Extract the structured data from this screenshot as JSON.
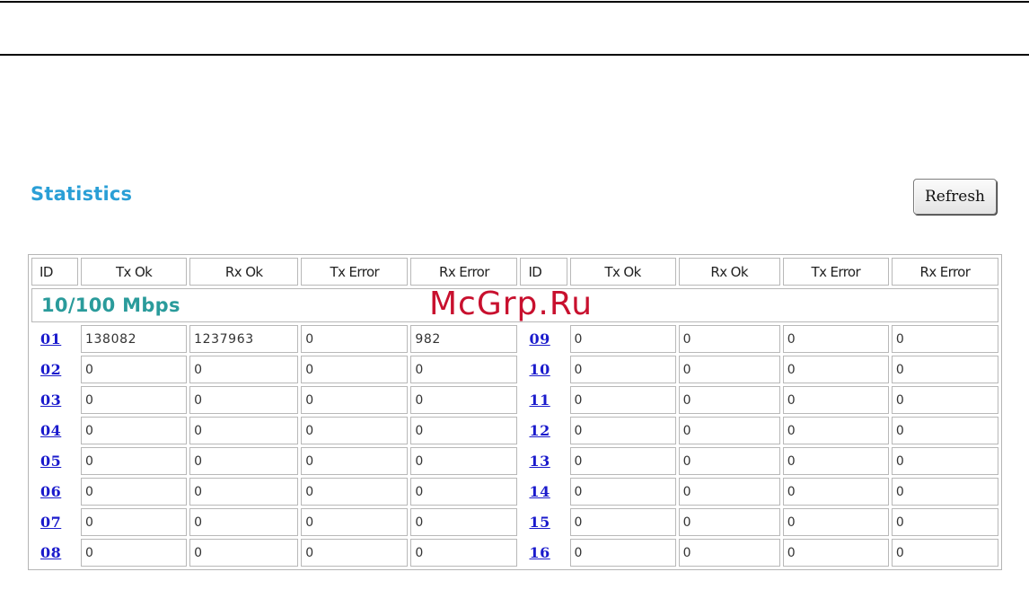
{
  "page": {
    "title": "Statistics",
    "refresh_label": "Refresh",
    "watermark": "McGrp.Ru"
  },
  "table": {
    "headers": [
      "ID",
      "Tx Ok",
      "Rx Ok",
      "Tx Error",
      "Rx Error",
      "ID",
      "Tx Ok",
      "Rx Ok",
      "Tx Error",
      "Rx Error"
    ],
    "section_label": "10/100 Mbps",
    "rows": [
      {
        "left_id": "01",
        "left_tx_ok": "138082",
        "left_rx_ok": "1237963",
        "left_tx_err": "0",
        "left_rx_err": "982",
        "right_id": "09",
        "right_tx_ok": "0",
        "right_rx_ok": "0",
        "right_tx_err": "0",
        "right_rx_err": "0"
      },
      {
        "left_id": "02",
        "left_tx_ok": "0",
        "left_rx_ok": "0",
        "left_tx_err": "0",
        "left_rx_err": "0",
        "right_id": "10",
        "right_tx_ok": "0",
        "right_rx_ok": "0",
        "right_tx_err": "0",
        "right_rx_err": "0"
      },
      {
        "left_id": "03",
        "left_tx_ok": "0",
        "left_rx_ok": "0",
        "left_tx_err": "0",
        "left_rx_err": "0",
        "right_id": "11",
        "right_tx_ok": "0",
        "right_rx_ok": "0",
        "right_tx_err": "0",
        "right_rx_err": "0"
      },
      {
        "left_id": "04",
        "left_tx_ok": "0",
        "left_rx_ok": "0",
        "left_tx_err": "0",
        "left_rx_err": "0",
        "right_id": "12",
        "right_tx_ok": "0",
        "right_rx_ok": "0",
        "right_tx_err": "0",
        "right_rx_err": "0"
      },
      {
        "left_id": "05",
        "left_tx_ok": "0",
        "left_rx_ok": "0",
        "left_tx_err": "0",
        "left_rx_err": "0",
        "right_id": "13",
        "right_tx_ok": "0",
        "right_rx_ok": "0",
        "right_tx_err": "0",
        "right_rx_err": "0"
      },
      {
        "left_id": "06",
        "left_tx_ok": "0",
        "left_rx_ok": "0",
        "left_tx_err": "0",
        "left_rx_err": "0",
        "right_id": "14",
        "right_tx_ok": "0",
        "right_rx_ok": "0",
        "right_tx_err": "0",
        "right_rx_err": "0"
      },
      {
        "left_id": "07",
        "left_tx_ok": "0",
        "left_rx_ok": "0",
        "left_tx_err": "0",
        "left_rx_err": "0",
        "right_id": "15",
        "right_tx_ok": "0",
        "right_rx_ok": "0",
        "right_tx_err": "0",
        "right_rx_err": "0"
      },
      {
        "left_id": "08",
        "left_tx_ok": "0",
        "left_rx_ok": "0",
        "left_tx_err": "0",
        "left_rx_err": "0",
        "right_id": "16",
        "right_tx_ok": "0",
        "right_rx_ok": "0",
        "right_tx_err": "0",
        "right_rx_err": "0"
      }
    ]
  },
  "colors": {
    "title": "#2a9fd6",
    "section_label": "#2a9b9b",
    "port_link": "#1a1acc",
    "watermark": "#c8102e"
  }
}
